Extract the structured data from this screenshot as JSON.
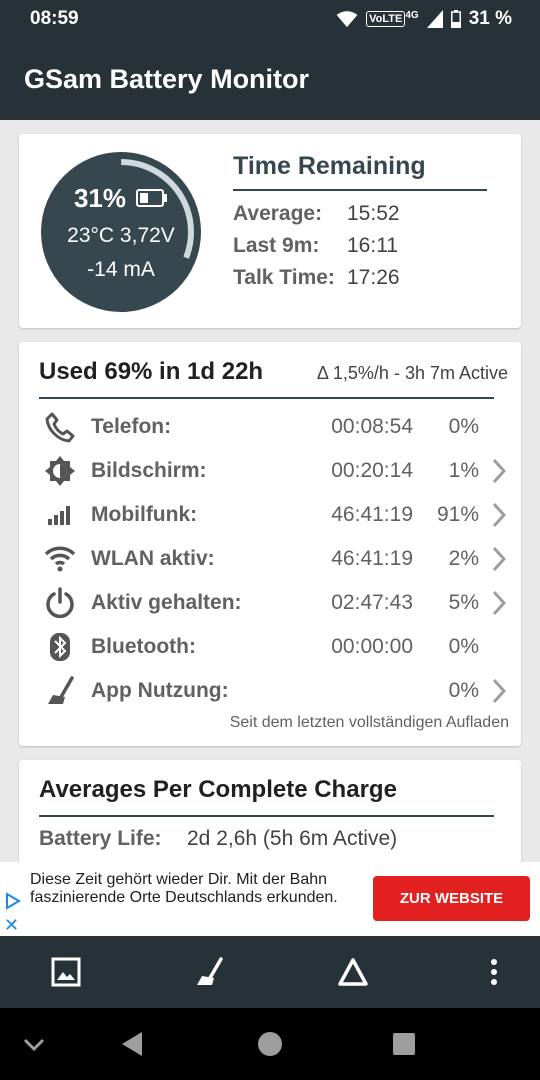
{
  "status_bar": {
    "time": "08:59",
    "volte": "VoLTE",
    "network": "4G",
    "battery": "31 %"
  },
  "app_bar": {
    "title": "GSam Battery Monitor"
  },
  "battery_card": {
    "level_fraction": 0.31,
    "percent": "31%",
    "temp_voltage": "23°C  3,72V",
    "current": "-14 mA",
    "time_remaining_title": "Time Remaining",
    "rows": [
      {
        "label": "Average:",
        "value": "15:52"
      },
      {
        "label": "Last 9m:",
        "value": "16:11"
      },
      {
        "label": "Talk Time:",
        "value": "17:26"
      }
    ]
  },
  "usage_card": {
    "title": "Used 69% in 1d 22h",
    "subtitle": "Δ 1,5%/h - 3h 7m Active",
    "rows": [
      {
        "icon": "phone-icon",
        "name": "Telefon:",
        "duration": "00:08:54",
        "percent": "0%",
        "has_chevron": false
      },
      {
        "icon": "brightness-icon",
        "name": "Bildschirm:",
        "duration": "00:20:14",
        "percent": "1%",
        "has_chevron": true
      },
      {
        "icon": "signal-bars-icon",
        "name": "Mobilfunk:",
        "duration": "46:41:19",
        "percent": "91%",
        "has_chevron": true
      },
      {
        "icon": "wifi-icon",
        "name": "WLAN aktiv:",
        "duration": "46:41:19",
        "percent": "2%",
        "has_chevron": true
      },
      {
        "icon": "power-icon",
        "name": "Aktiv gehalten:",
        "duration": "02:47:43",
        "percent": "5%",
        "has_chevron": true
      },
      {
        "icon": "bluetooth-icon",
        "name": "Bluetooth:",
        "duration": "00:00:00",
        "percent": "0%",
        "has_chevron": false
      },
      {
        "icon": "broom-icon",
        "name": "App Nutzung:",
        "duration": "",
        "percent": "0%",
        "has_chevron": true
      }
    ],
    "footnote": "Seit dem letzten vollständigen Aufladen"
  },
  "averages_card": {
    "title": "Averages Per Complete Charge",
    "rows": [
      {
        "label": "Battery Life:",
        "value": "2d 2,6h (5h 6m Active)"
      }
    ]
  },
  "ad": {
    "text": "Diese Zeit gehört wieder Dir. Mit der Bahn faszinierende Orte Deutschlands erkunden.",
    "button_label": "ZUR WEBSITE",
    "close_symbol": "✕"
  },
  "colors": {
    "bar": "#263238",
    "accent_ring": "#37474f",
    "ad_button": "#e32020"
  }
}
